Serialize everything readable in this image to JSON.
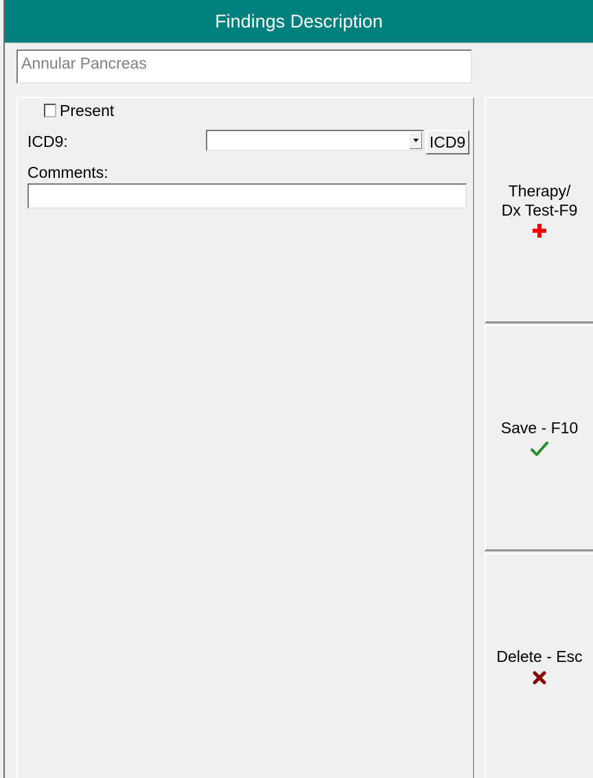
{
  "header": {
    "title": "Findings Description"
  },
  "finding": {
    "name": "Annular Pancreas"
  },
  "form": {
    "present_label": "Present",
    "present_checked": false,
    "icd9_label": "ICD9:",
    "icd9_value": "",
    "icd9_button_label": "ICD9",
    "comments_label": "Comments:",
    "comments_value": ""
  },
  "actions": {
    "therapy_label": "Therapy/\nDx Test-F9",
    "therapy_icon": "red-cross-icon",
    "save_label": "Save - F10",
    "save_icon": "green-check-icon",
    "delete_label": "Delete - Esc",
    "delete_icon": "red-x-icon"
  },
  "colors": {
    "header_bg": "#007f7f",
    "cross": "#ff0000",
    "check": "#2e8b2e",
    "x_mark": "#8b0000"
  }
}
